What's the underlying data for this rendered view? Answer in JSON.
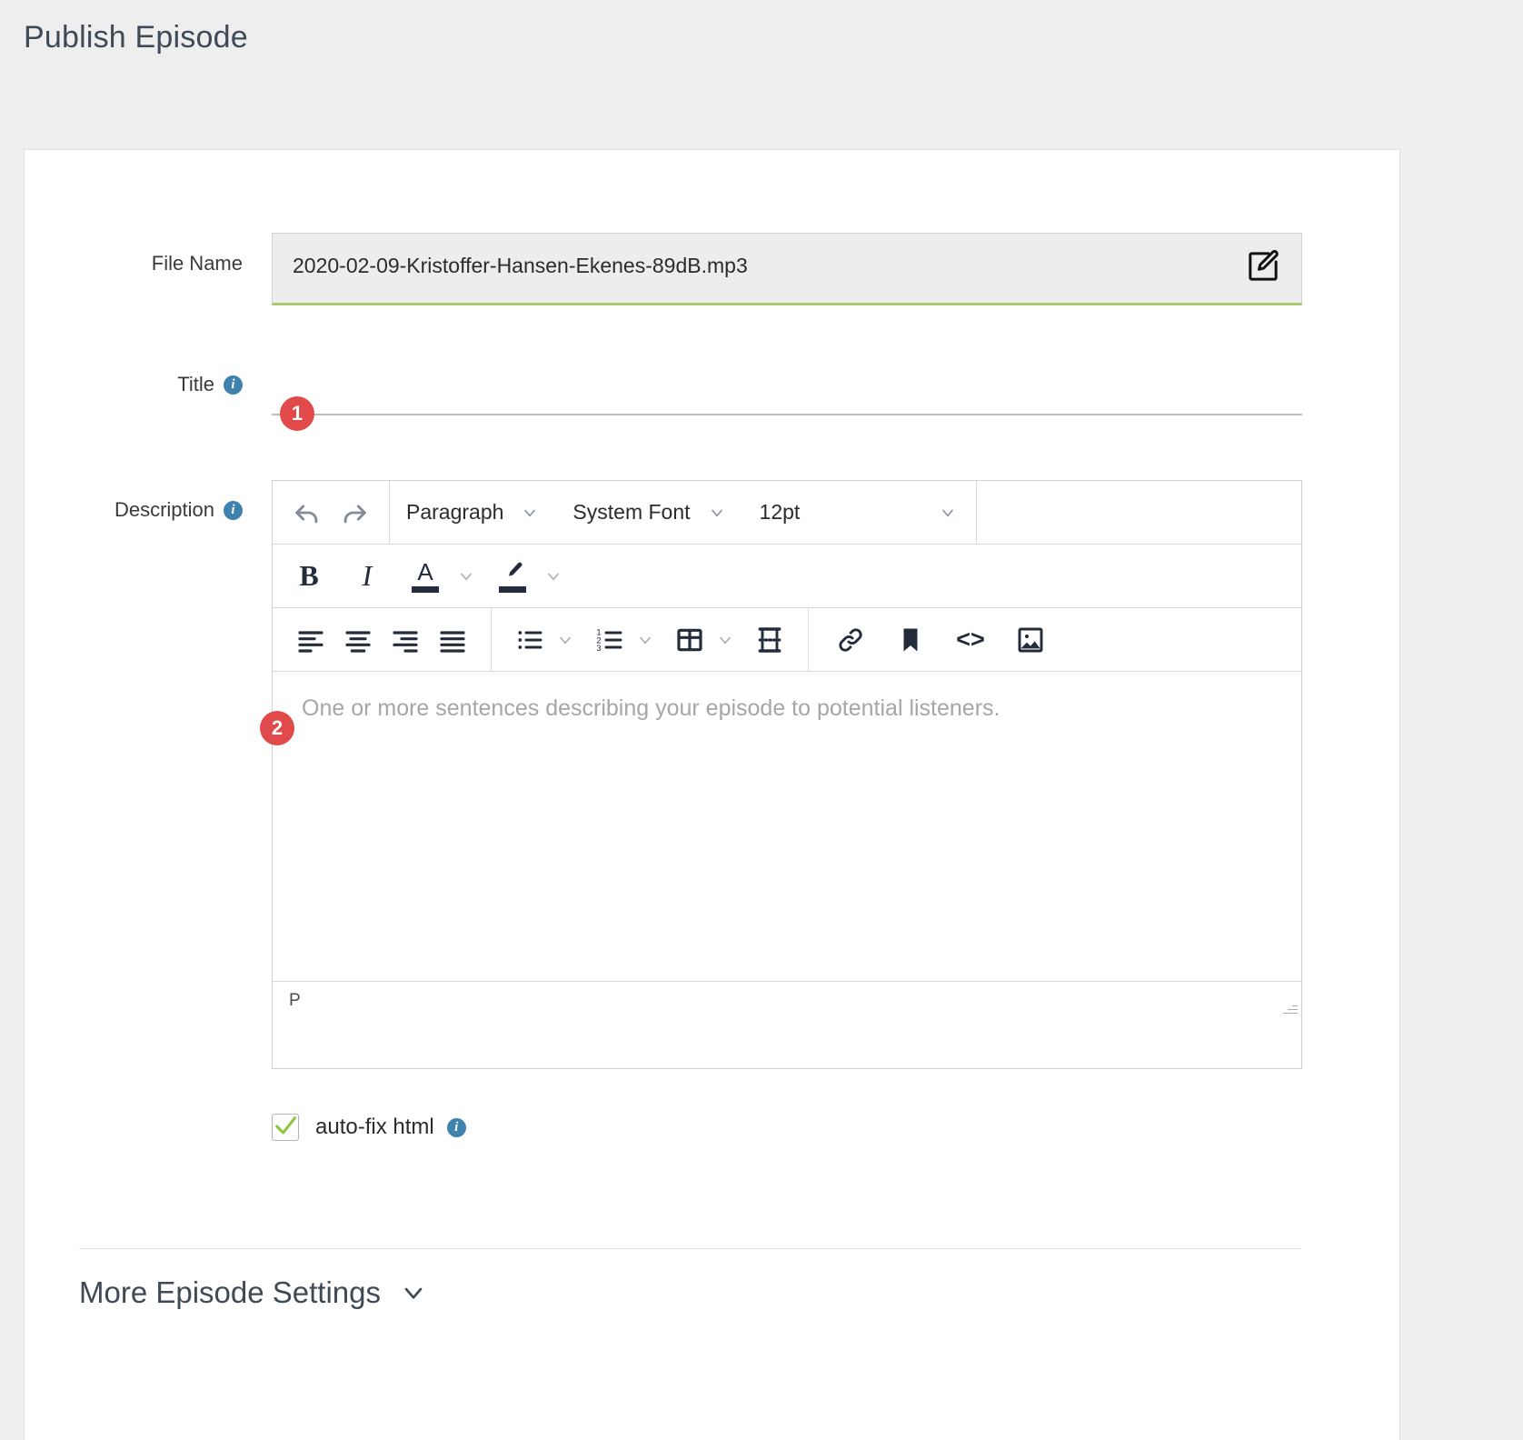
{
  "page": {
    "title": "Publish Episode"
  },
  "form": {
    "file_name": {
      "label": "File Name",
      "value": "2020-02-09-Kristoffer-Hansen-Ekenes-89dB.mp3",
      "edit_icon": "edit-square-icon"
    },
    "title": {
      "label": "Title",
      "value": "",
      "placeholder": "",
      "info_icon": "info-icon",
      "badge": "1"
    },
    "description": {
      "label": "Description",
      "info_icon": "info-icon",
      "badge": "2",
      "placeholder": "One or more sentences describing your episode to potential listeners.",
      "value": "",
      "status_path": "P",
      "toolbar": {
        "row1": {
          "undo": "undo-icon",
          "redo": "redo-icon",
          "block_format": "Paragraph",
          "font_family": "System Font",
          "font_size": "12pt"
        },
        "row2": {
          "bold": "B",
          "italic": "I",
          "text_color": "A",
          "highlight": "highlight-pen-icon"
        },
        "row3": {
          "align_left": "align-left-icon",
          "align_center": "align-center-icon",
          "align_right": "align-right-icon",
          "align_justify": "align-justify-icon",
          "bullet_list": "bullet-list-icon",
          "numbered_list": "numbered-list-icon",
          "table": "table-icon",
          "page_break": "page-break-icon",
          "link": "link-icon",
          "bookmark": "bookmark-icon",
          "source_code": "<>",
          "image": "image-icon"
        }
      }
    },
    "auto_fix_html": {
      "label": "auto-fix html",
      "checked": true,
      "info_icon": "info-icon"
    }
  },
  "footer": {
    "more_settings_label": "More Episode Settings",
    "chevron": "chevron-down-icon"
  },
  "colors": {
    "accent_green": "#aacb6f",
    "badge_red": "#e04a4a",
    "info_blue": "#3f82ad",
    "heading": "#3f4a56"
  }
}
